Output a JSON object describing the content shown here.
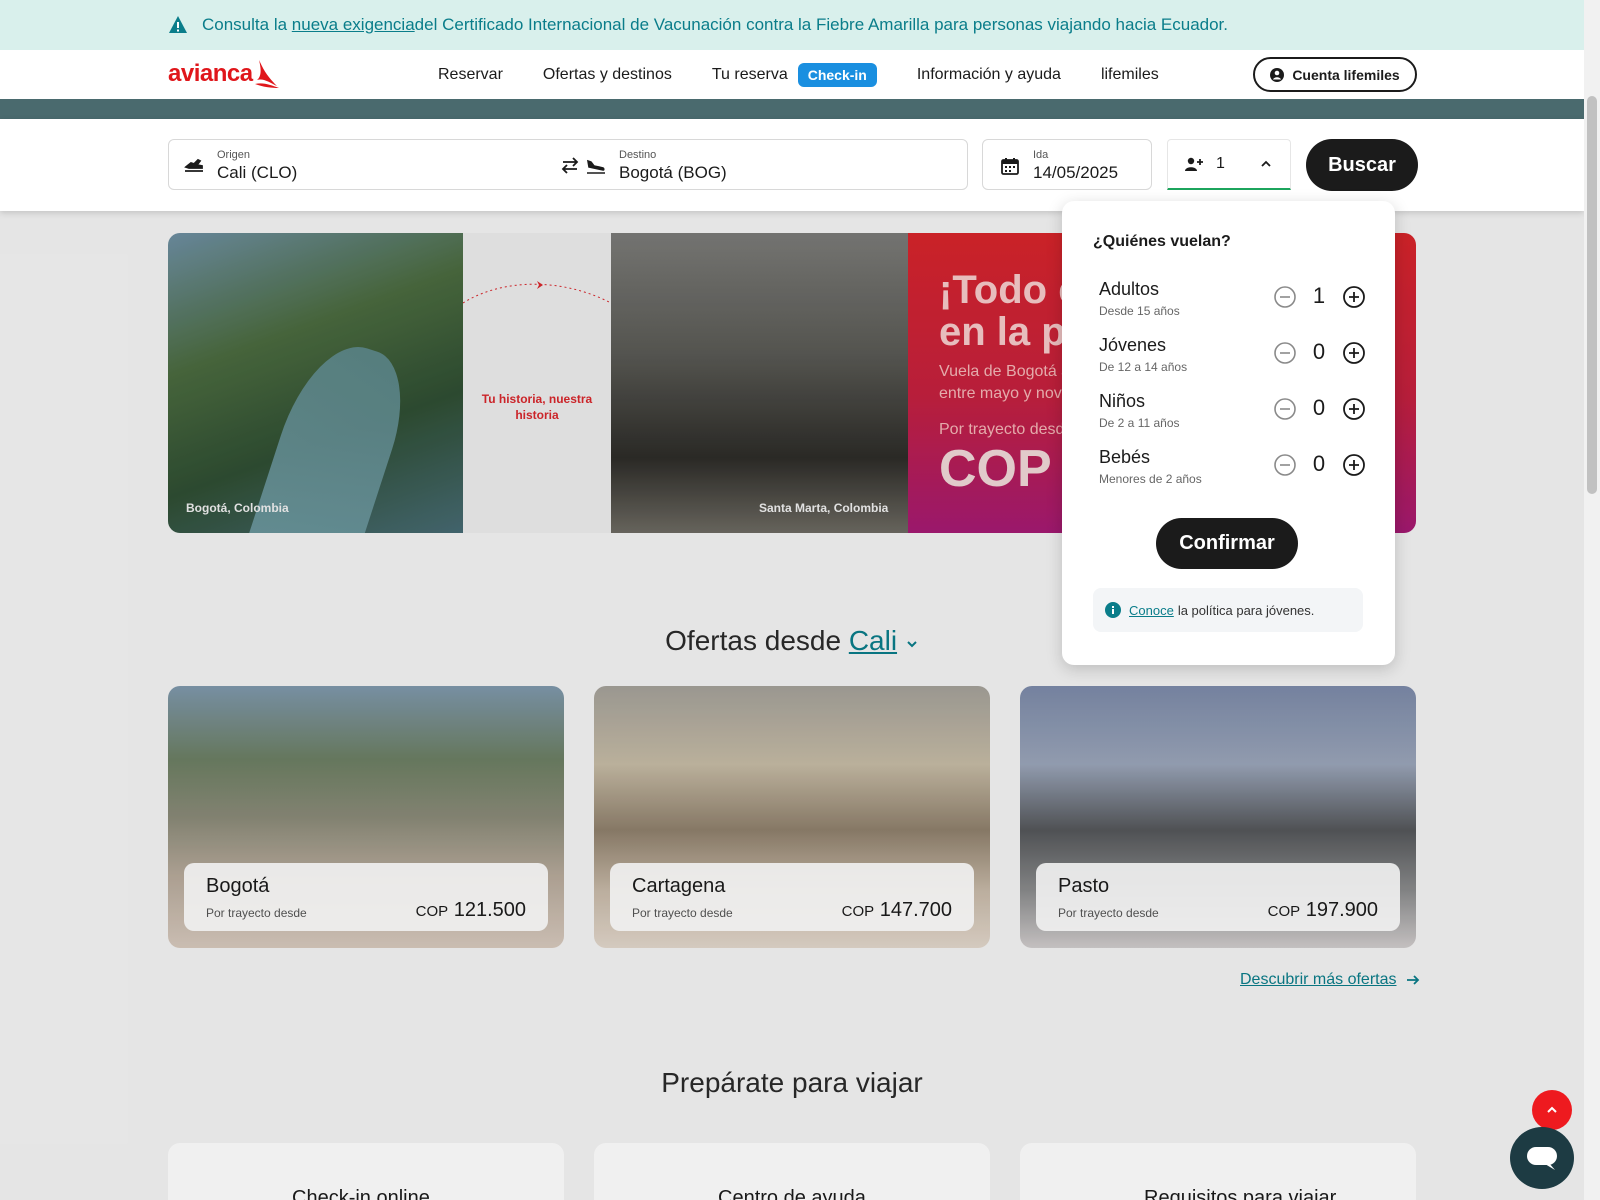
{
  "banner": {
    "text_before": "Consulta la ",
    "link": "nueva exigencia",
    "text_after": " del Certificado Internacional de Vacunación contra la Fiebre Amarilla para personas viajando hacia Ecuador.",
    "icon": "warning-icon"
  },
  "header": {
    "logo": "avianca",
    "nav": [
      "Reservar",
      "Ofertas y destinos",
      "Tu reserva",
      "Información y ayuda",
      "lifemiles"
    ],
    "checkin_badge": "Check-in",
    "account_button": "Cuenta lifemiles"
  },
  "search": {
    "origin_label": "Origen",
    "origin_value": "Cali (CLO)",
    "destination_label": "Destino",
    "destination_value": "Bogotá (BOG)",
    "date_label": "Ida",
    "date_value": "14/05/2025",
    "passengers": "1",
    "search_button": "Buscar"
  },
  "hero": {
    "caption_left": "Bogotá, Colombia",
    "story_text": "Tu historia, nuestra historia",
    "caption_right": "Santa Marta, Colombia",
    "promo_title_line1": "¡Todo e",
    "promo_title_line2": "en la p",
    "promo_sub_line1": "Vuela de Bogotá a",
    "promo_sub_line2": "entre mayo y nov",
    "promo_from": "Por trayecto desd",
    "promo_currency": "COP"
  },
  "offers": {
    "title": "Ofertas desde",
    "city": "Cali",
    "cards": [
      {
        "city": "Bogotá",
        "from": "Por trayecto desde",
        "currency": "COP",
        "price": "121.500"
      },
      {
        "city": "Cartagena",
        "from": "Por trayecto desde",
        "currency": "COP",
        "price": "147.700"
      },
      {
        "city": "Pasto",
        "from": "Por trayecto desde",
        "currency": "COP",
        "price": "197.900"
      }
    ],
    "more_link": "Descubrir más ofertas"
  },
  "prepare": {
    "title": "Prepárate para viajar",
    "cards": [
      "Check-in online",
      "Centro de ayuda",
      "Requisitos para viajar"
    ]
  },
  "passenger_popover": {
    "title": "¿Quiénes vuelan?",
    "rows": [
      {
        "label": "Adultos",
        "sub": "Desde 15 años",
        "count": "1"
      },
      {
        "label": "Jóvenes",
        "sub": "De 12 a 14 años",
        "count": "0"
      },
      {
        "label": "Niños",
        "sub": "De 2 a 11 años",
        "count": "0"
      },
      {
        "label": "Bebés",
        "sub": "Menores de 2 años",
        "count": "0"
      }
    ],
    "confirm_button": "Confirmar",
    "policy_link": "Conoce",
    "policy_text": "la política para jóvenes."
  },
  "colors": {
    "brand_red": "#e0161b",
    "teal": "#0a7d8a",
    "checkin_blue": "#1a8fe0",
    "button_black": "#1b1b1b"
  }
}
